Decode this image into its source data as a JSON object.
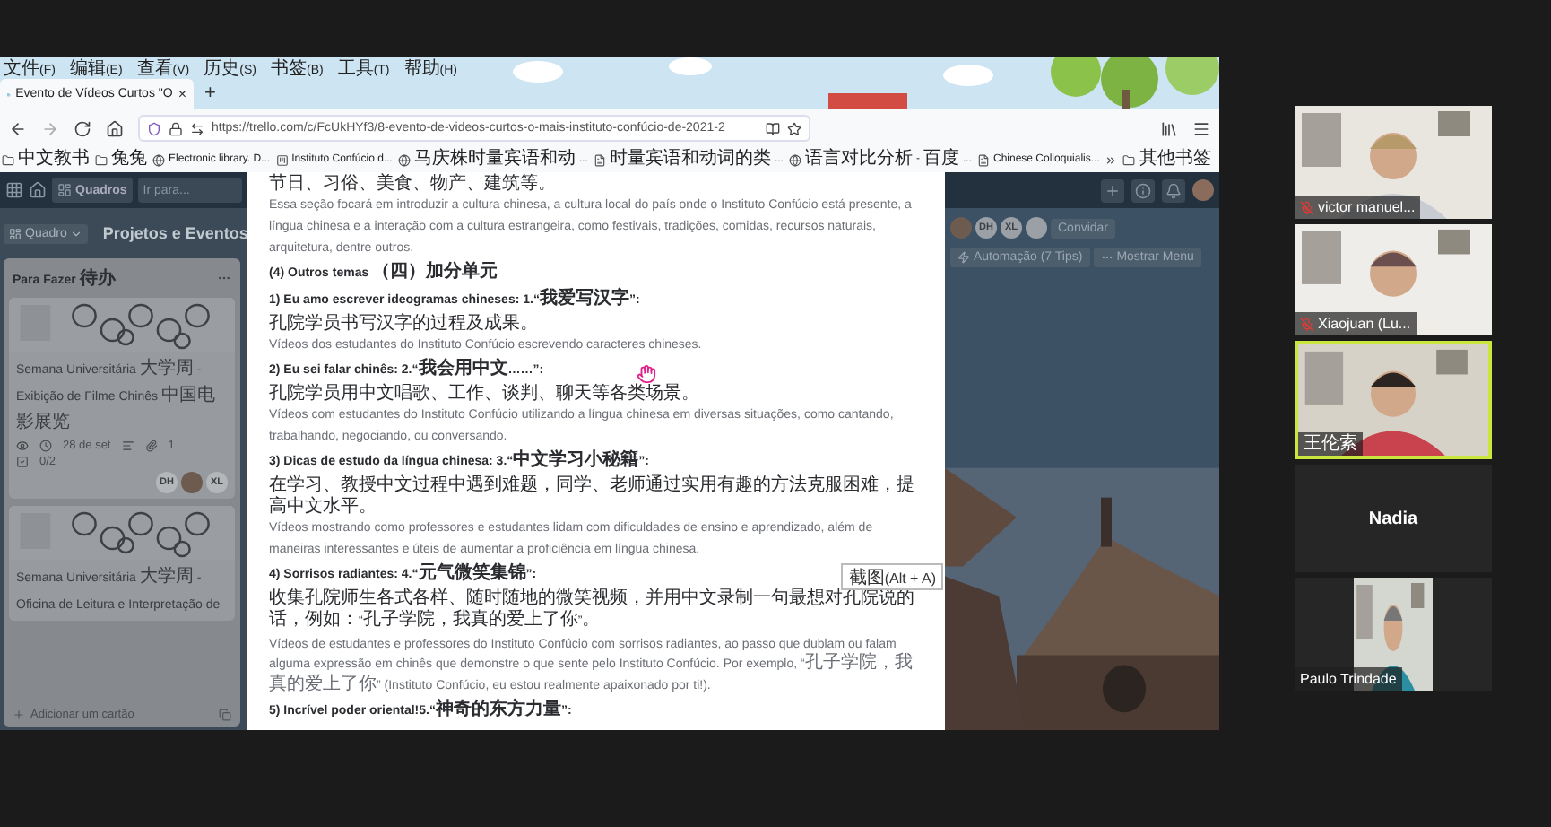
{
  "browser": {
    "menu": [
      "文件(F)",
      "编辑(E)",
      "查看(V)",
      "历史(S)",
      "书签(B)",
      "工具(T)",
      "帮助(H)"
    ],
    "tab": {
      "title": "Evento de Vídeos Curtos \"O",
      "close": "×"
    },
    "new_tab": "+",
    "address": "https://trello.com/c/FcUkHYf3/8-evento-de-videos-curtos-o-mais-instituto-confúcio-de-2021-2",
    "bookmarks": [
      {
        "label": "中文教书",
        "kind": "folder"
      },
      {
        "label": "兔兔",
        "kind": "folder"
      },
      {
        "label": "Electronic library. D...",
        "kind": "globe"
      },
      {
        "label": "Instituto Confúcio d...",
        "kind": "board"
      },
      {
        "label": "马庆株时量宾语和动...",
        "kind": "globe"
      },
      {
        "label": "时量宾语和动词的类...",
        "kind": "doc"
      },
      {
        "label": "语言对比分析 - 百度...",
        "kind": "globe"
      },
      {
        "label": "Chinese Colloquialis...",
        "kind": "doc"
      }
    ],
    "other_bookmarks": "其他书签"
  },
  "trello": {
    "boards": "Quadros",
    "search_placeholder": "Ir para...",
    "board_view": "Quadro",
    "board_title": "Projetos e Eventos",
    "members": [
      "DH",
      "XL"
    ],
    "invite": "Convidar",
    "automation": "Automação (7 Tips)",
    "show_menu": "Mostrar Menu",
    "list": {
      "title": "Para Fazer 待办",
      "cards": [
        {
          "title": "Semana Universitária 大学周 - Exibição de Filme Chinês 中国电影展览",
          "due": "28 de set",
          "attachments": "1",
          "checklist": "0/2",
          "members": [
            "DH",
            "XL"
          ]
        },
        {
          "title": "Semana Universitária 大学周 - Oficina de Leitura e Interpretação de"
        }
      ],
      "add_card": "Adicionar um cartão"
    }
  },
  "card_detail": {
    "blocks": [
      {
        "kind": "cn",
        "text": "节日、习俗、美食、物产、建筑等。"
      },
      {
        "kind": "pt",
        "text": "Essa seção focará em introduzir a cultura chinesa, a cultura local do país onde o Instituto Confúcio está presente, a língua chinesa e a interação com a cultura estrangeira, como festivais, tradições, comidas, recursos naturais, arquitetura, dentre outros."
      },
      {
        "kind": "heading",
        "text": "(4) Outros temas （四）加分单元"
      },
      {
        "kind": "heading",
        "text": "1) Eu amo escrever ideogramas chineses: 1.“我爱写汉字”:"
      },
      {
        "kind": "cn",
        "text": "孔院学员书写汉字的过程及成果。"
      },
      {
        "kind": "pt",
        "text": "Vídeos dos estudantes do Instituto Confúcio escrevendo caracteres chineses."
      },
      {
        "kind": "heading",
        "text": "2) Eu sei falar chinês: 2.“我会用中文……”:"
      },
      {
        "kind": "cn",
        "text": "孔院学员用中文唱歌、工作、谈判、聊天等各类场景。"
      },
      {
        "kind": "pt",
        "text": "Vídeos com estudantes do Instituto Confúcio utilizando a língua chinesa em diversas situações, como cantando, trabalhando, negociando, ou conversando."
      },
      {
        "kind": "heading",
        "text": "3) Dicas de estudo da língua chinesa: 3.“中文学习小秘籍”:"
      },
      {
        "kind": "cn",
        "text": "在学习、教授中文过程中遇到难题，同学、老师通过实用有趣的方法克服困难，提高中文水平。"
      },
      {
        "kind": "pt",
        "text": "Vídeos mostrando como professores e estudantes lidam com dificuldades de ensino e aprendizado, além de maneiras interessantes e úteis de aumentar a proficiência em língua chinesa."
      },
      {
        "kind": "heading",
        "text": "4) Sorrisos radiantes: 4.“元气微笑集锦”:"
      },
      {
        "kind": "cn",
        "text": "收集孔院师生各式各样、随时随地的微笑视频，并用中文录制一句最想对孔院说的话，例如：“孔子学院，我真的爱上了你”。"
      },
      {
        "kind": "pt",
        "text": "Vídeos de estudantes e professores do Instituto Confúcio com sorrisos radiantes, ao passo que dublam ou falam alguma expressão em chinês que demonstre o que sente pelo Instituto Confúcio. Por exemplo, “孔子学院，我真的爱上了你” (Instituto Confúcio, eu estou realmente apaixonado por ti!)."
      },
      {
        "kind": "heading",
        "text": "5) Incrível poder oriental!5.“神奇的东方力量”:"
      }
    ],
    "tooltip": "截图(Alt + A)"
  },
  "participants": [
    {
      "name": "victor manuel...",
      "kind": "video",
      "muted": true,
      "speaking": false
    },
    {
      "name": "Xiaojuan  (Lu...",
      "kind": "video",
      "muted": true,
      "speaking": false
    },
    {
      "name": "王伦索",
      "kind": "video",
      "muted": false,
      "speaking": true
    },
    {
      "name": "Nadia",
      "kind": "name",
      "muted": false,
      "speaking": false
    },
    {
      "name": "Paulo Trindade",
      "kind": "portrait",
      "muted": false,
      "speaking": false
    }
  ]
}
